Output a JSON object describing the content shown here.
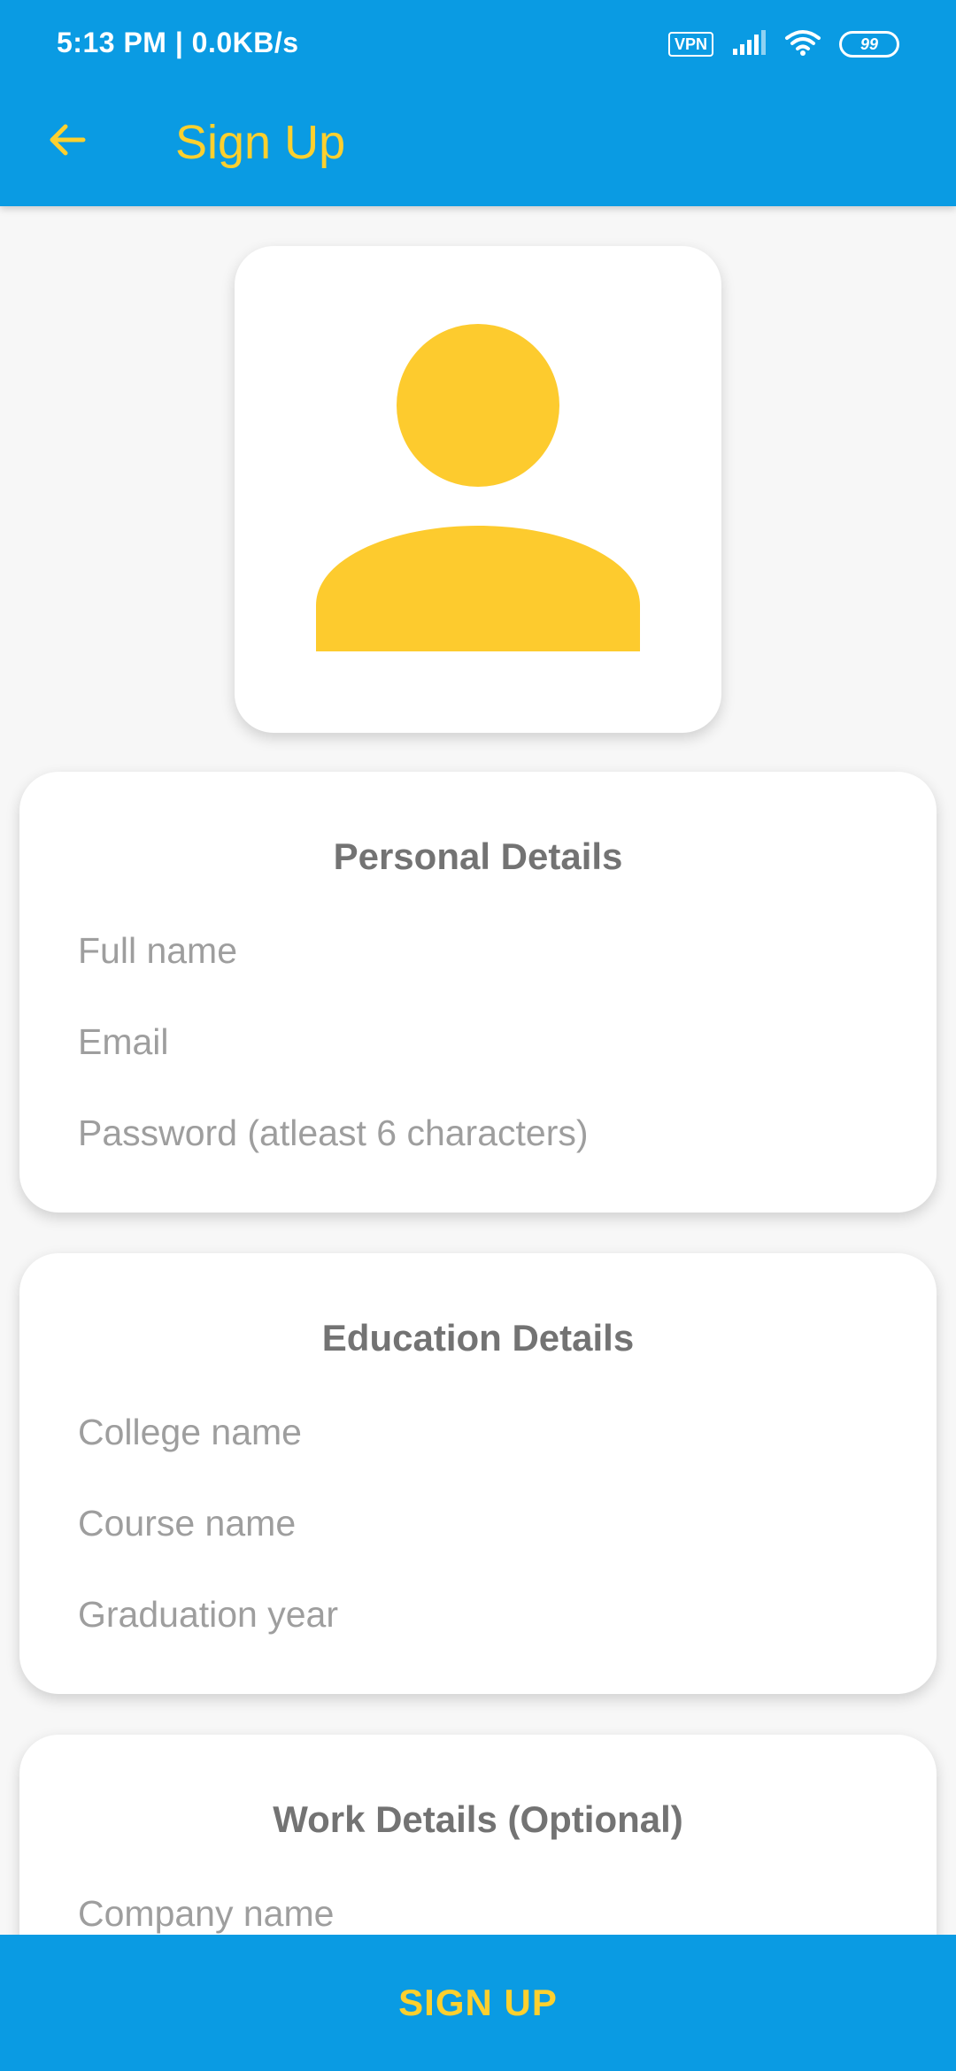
{
  "status_bar": {
    "time": "5:13 PM | 0.0KB/s",
    "vpn": "VPN",
    "battery": "99",
    "icons": [
      "signal-icon",
      "wifi-icon",
      "battery-icon"
    ]
  },
  "app_bar": {
    "back_icon": "arrow-back-icon",
    "title": "Sign Up"
  },
  "avatar": {
    "icon": "person-icon"
  },
  "personal": {
    "title": "Personal Details",
    "full_name_placeholder": "Full name",
    "email_placeholder": "Email",
    "password_placeholder": "Password (atleast 6 characters)"
  },
  "education": {
    "title": "Education Details",
    "college_placeholder": "College name",
    "course_placeholder": "Course name",
    "graduation_placeholder": "Graduation year"
  },
  "work": {
    "title": "Work Details (Optional)",
    "company_placeholder": "Company name"
  },
  "signup_button": {
    "label": "SIGN UP"
  },
  "colors": {
    "primary": "#0A9BE3",
    "accent": "#FDD02E",
    "background": "#F7F7F7",
    "card": "#FFFFFF",
    "title_text": "#737373",
    "hint_text": "#9E9E9E"
  }
}
